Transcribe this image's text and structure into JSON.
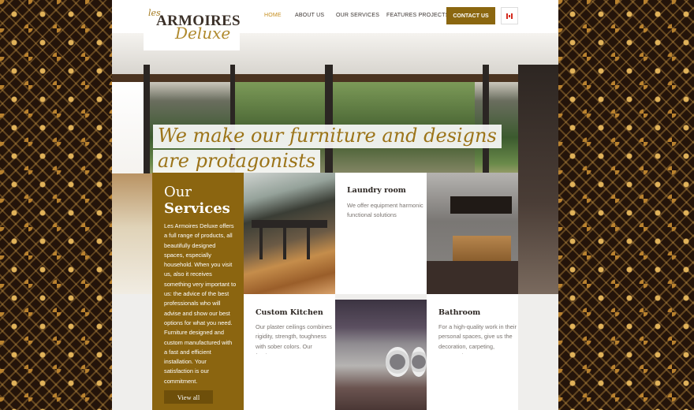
{
  "brand": {
    "les": "les",
    "name": "ARMOIRES",
    "deluxe": "Deluxe"
  },
  "nav": {
    "items": [
      "HOME",
      "ABOUT US",
      "OUR SERVICES",
      "FEATURES PROJECTS"
    ],
    "active": "HOME",
    "contact": "CONTACT US",
    "language_flag": "canada-flag-icon"
  },
  "hero": {
    "line1": "We make our furniture and designs",
    "line2": "are protagonists"
  },
  "services": {
    "heading_1": "Our",
    "heading_2": "Services",
    "description": "Les Armoires Deluxe offers a full range of products, all beautifully designed spaces, especially household. When you visit us, also it receives something very important to us: the advice of the best professionals who will advise and show our best options for what you need. Furniture designed and custom manufactured with a fast and efficient installation. Your satisfaction is our commitment.",
    "view_all": "View all"
  },
  "cards": [
    {
      "title": "Laundry room",
      "text": "We offer equipment harmonic functional solutions"
    },
    {
      "title": "Custom Kitchen",
      "text": "Our plaster ceilings combines rigidity, strength, toughness with sober colors. Our furniture..."
    },
    {
      "title": "Bathroom",
      "text": "For a high-quality work in their personal spaces, give us the decoration, carpeting, accessories"
    }
  ],
  "colors": {
    "accent": "#8b6510",
    "gold": "#c58d1d",
    "title_gold": "#9c7419"
  }
}
